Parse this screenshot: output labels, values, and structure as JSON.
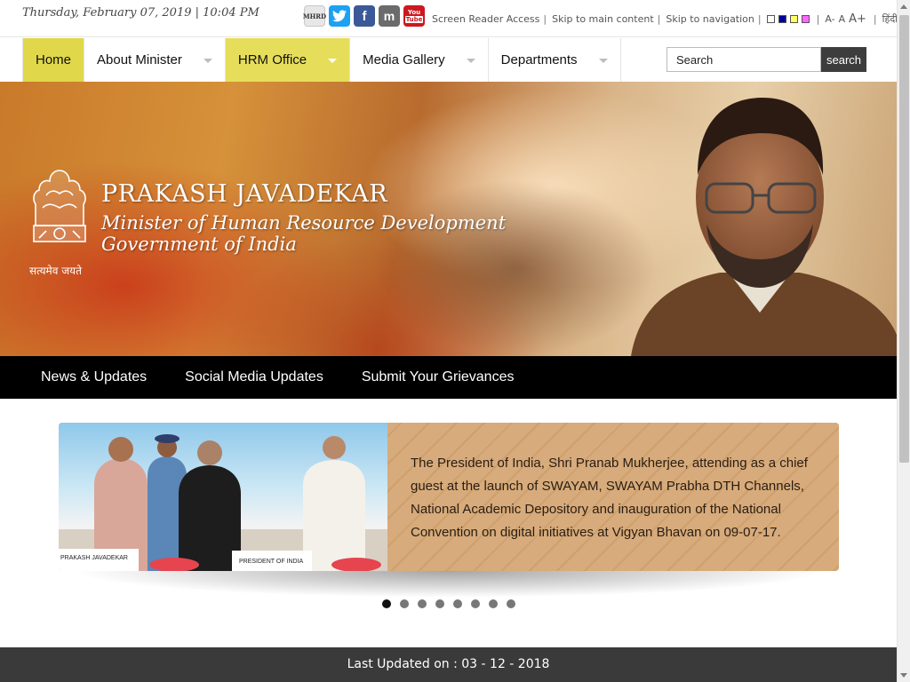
{
  "top_bar": {
    "date_time": "Thursday, February 07, 2019 | 10:04 PM",
    "social": {
      "mhrd_label": "MHRD",
      "twitter_glyph": "t",
      "facebook_glyph": "f",
      "m_glyph": "m",
      "youtube_label_top": "You",
      "youtube_label_bottom": "Tube"
    },
    "links": {
      "screen_reader": "Screen Reader Access",
      "skip_main": "Skip to main content",
      "skip_nav": "Skip to navigation",
      "separator": "|"
    },
    "color_themes": [
      "#ffffff",
      "#000099",
      "#ffff66",
      "#ff66ff"
    ],
    "font_sizes": {
      "decrease": "A-",
      "normal": "A",
      "increase": "A+"
    },
    "language": "हिंदी में"
  },
  "main_nav": {
    "items": [
      {
        "label": "Home"
      },
      {
        "label": "About Minister"
      },
      {
        "label": "HRM Office"
      },
      {
        "label": "Media Gallery"
      },
      {
        "label": "Departments"
      }
    ],
    "search": {
      "placeholder": "Search",
      "value": "Search",
      "button": "search"
    },
    "active_color": "#e0d84a"
  },
  "banner": {
    "motto": "सत्यमेव जयते",
    "name": "PRAKASH JAVADEKAR",
    "title_line1": "Minister of Human Resource Development",
    "title_line2": "Government of India"
  },
  "sub_nav": {
    "items": [
      {
        "label": "News & Updates"
      },
      {
        "label": "Social Media Updates"
      },
      {
        "label": "Submit Your Grievances"
      }
    ]
  },
  "slider": {
    "caption": "The President of India, Shri Pranab Mukherjee, attending as a chief guest at the launch of SWAYAM, SWAYAM Prabha DTH Channels, National Academic Depository and inauguration of the National Convention on digital initiatives at Vigyan Bhavan on 09-07-17.",
    "nameplate_left": "PRAKASH JAVADEKAR",
    "nameplate_center": "PRESIDENT OF INDIA",
    "dot_count": 8,
    "active_index": 0
  },
  "footer": {
    "last_updated": "Last Updated on : 03 - 12 - 2018"
  }
}
